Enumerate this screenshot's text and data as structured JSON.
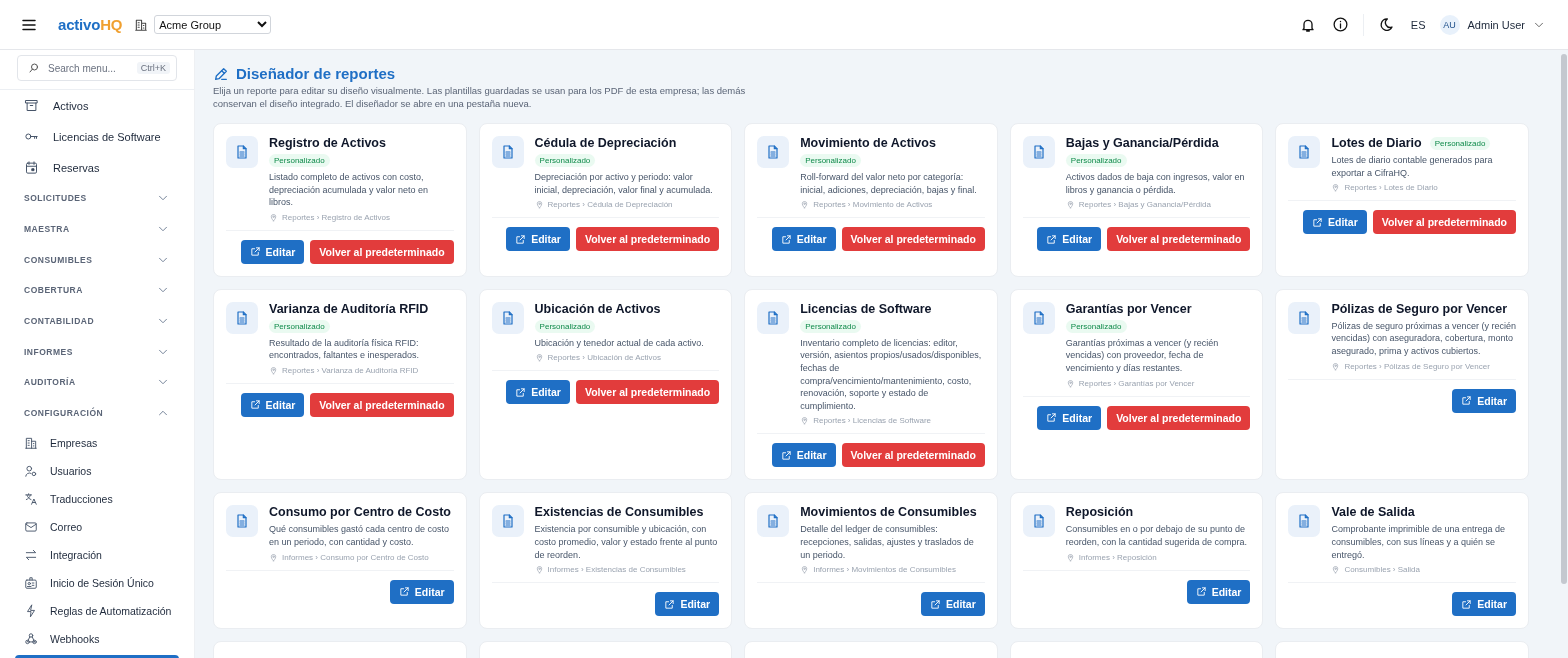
{
  "header": {
    "brand": {
      "part_1": "activo",
      "part_2": "HQ"
    },
    "company_select": {
      "value": "Acme Group"
    },
    "language": "ES",
    "user": {
      "initials": "AU",
      "name": "Admin User"
    }
  },
  "sidebar": {
    "search": {
      "placeholder": "Search menu...",
      "shortcut": "Ctrl+K"
    },
    "items": [
      {
        "kind": "link",
        "label": "Activos"
      },
      {
        "kind": "link",
        "label": "Licencias de Software"
      },
      {
        "kind": "link",
        "label": "Reservas"
      },
      {
        "kind": "group",
        "label": "SOLICITUDES",
        "expanded": false
      },
      {
        "kind": "group",
        "label": "MAESTRA",
        "expanded": false
      },
      {
        "kind": "group",
        "label": "CONSUMIBLES",
        "expanded": false
      },
      {
        "kind": "group",
        "label": "COBERTURA",
        "expanded": false
      },
      {
        "kind": "group",
        "label": "CONTABILIDAD",
        "expanded": false
      },
      {
        "kind": "group",
        "label": "INFORMES",
        "expanded": false
      },
      {
        "kind": "group",
        "label": "AUDITORÍA",
        "expanded": false
      },
      {
        "kind": "group",
        "label": "CONFIGURACIÓN",
        "expanded": true,
        "children": [
          {
            "label": "Empresas"
          },
          {
            "label": "Usuarios"
          },
          {
            "label": "Traducciones"
          },
          {
            "label": "Correo"
          },
          {
            "label": "Integración"
          },
          {
            "label": "Inicio de Sesión Único"
          },
          {
            "label": "Reglas de Automatización"
          },
          {
            "label": "Webhooks"
          }
        ]
      }
    ]
  },
  "page": {
    "title": "Diseñador de reportes",
    "description": "Elija un reporte para editar su diseño visualmente. Las plantillas guardadas se usan para los PDF de esta empresa; las demás conservan el diseño integrado. El diseñador se abre en una pestaña nueva."
  },
  "reports": [
    {
      "title": "Registro de Activos",
      "customized": true,
      "badge": "Personalizado",
      "description": "Listado completo de activos con costo, depreciación acumulada y valor neto en libros.",
      "path": "Reportes › Registro de Activos",
      "edit": "Editar",
      "reset": "Volver al predeterminado"
    },
    {
      "title": "Cédula de Depreciación",
      "customized": true,
      "badge": "Personalizado",
      "description": "Depreciación por activo y periodo: valor inicial, depreciación, valor final y acumulada.",
      "path": "Reportes › Cédula de Depreciación",
      "edit": "Editar",
      "reset": "Volver al predeterminado"
    },
    {
      "title": "Movimiento de Activos",
      "customized": true,
      "badge": "Personalizado",
      "description": "Roll-forward del valor neto por categoría: inicial, adiciones, depreciación, bajas y final.",
      "path": "Reportes › Movimiento de Activos",
      "edit": "Editar",
      "reset": "Volver al predeterminado"
    },
    {
      "title": "Bajas y Ganancia/Pérdida",
      "customized": true,
      "badge": "Personalizado",
      "description": "Activos dados de baja con ingresos, valor en libros y ganancia o pérdida.",
      "path": "Reportes › Bajas y Ganancia/Pérdida",
      "edit": "Editar",
      "reset": "Volver al predeterminado"
    },
    {
      "title": "Lotes de Diario",
      "customized": true,
      "badge": "Personalizado",
      "description": "Lotes de diario contable generados para exportar a CifraHQ.",
      "path": "Reportes › Lotes de Diario",
      "edit": "Editar",
      "reset": "Volver al predeterminado"
    },
    {
      "title": "Varianza de Auditoría RFID",
      "customized": true,
      "badge": "Personalizado",
      "description": "Resultado de la auditoría física RFID: encontrados, faltantes e inesperados.",
      "path": "Reportes › Varianza de Auditoría RFID",
      "edit": "Editar",
      "reset": "Volver al predeterminado"
    },
    {
      "title": "Ubicación de Activos",
      "customized": true,
      "badge": "Personalizado",
      "description": "Ubicación y tenedor actual de cada activo.",
      "path": "Reportes › Ubicación de Activos",
      "edit": "Editar",
      "reset": "Volver al predeterminado"
    },
    {
      "title": "Licencias de Software",
      "customized": true,
      "badge": "Personalizado",
      "description": "Inventario completo de licencias: editor, versión, asientos propios/usados/disponibles, fechas de compra/vencimiento/mantenimiento, costo, renovación, soporte y estado de cumplimiento.",
      "path": "Reportes › Licencias de Software",
      "edit": "Editar",
      "reset": "Volver al predeterminado"
    },
    {
      "title": "Garantías por Vencer",
      "customized": true,
      "badge": "Personalizado",
      "description": "Garantías próximas a vencer (y recién vencidas) con proveedor, fecha de vencimiento y días restantes.",
      "path": "Reportes › Garantías por Vencer",
      "edit": "Editar",
      "reset": "Volver al predeterminado"
    },
    {
      "title": "Pólizas de Seguro por Vencer",
      "customized": false,
      "description": "Pólizas de seguro próximas a vencer (y recién vencidas) con aseguradora, cobertura, monto asegurado, prima y activos cubiertos.",
      "path": "Reportes › Pólizas de Seguro por Vencer",
      "edit": "Editar"
    },
    {
      "title": "Consumo por Centro de Costo",
      "customized": false,
      "description": "Qué consumibles gastó cada centro de costo en un periodo, con cantidad y costo.",
      "path": "Informes › Consumo por Centro de Costo",
      "edit": "Editar"
    },
    {
      "title": "Existencias de Consumibles",
      "customized": false,
      "description": "Existencia por consumible y ubicación, con costo promedio, valor y estado frente al punto de reorden.",
      "path": "Informes › Existencias de Consumibles",
      "edit": "Editar"
    },
    {
      "title": "Movimientos de Consumibles",
      "customized": false,
      "description": "Detalle del ledger de consumibles: recepciones, salidas, ajustes y traslados de un periodo.",
      "path": "Informes › Movimientos de Consumibles",
      "edit": "Editar"
    },
    {
      "title": "Reposición",
      "customized": false,
      "description": "Consumibles en o por debajo de su punto de reorden, con la cantidad sugerida de compra.",
      "path": "Informes › Reposición",
      "edit": "Editar"
    },
    {
      "title": "Vale de Salida",
      "customized": false,
      "description": "Comprobante imprimible de una entrega de consumibles, con sus líneas y a quién se entregó.",
      "path": "Consumibles › Salida",
      "edit": "Editar"
    }
  ]
}
